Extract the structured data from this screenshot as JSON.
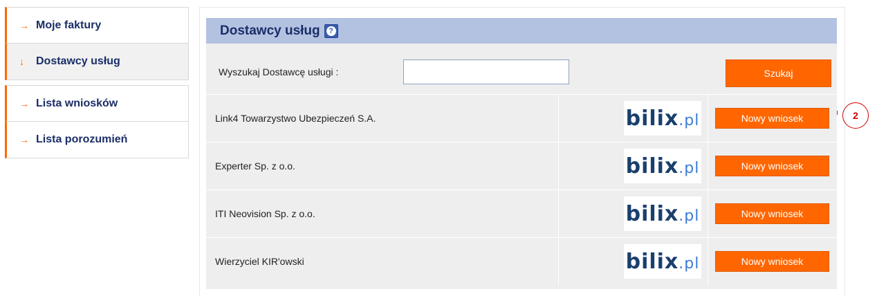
{
  "sidebar": {
    "items": [
      {
        "label": "Moje faktury",
        "arrow": "→",
        "active": false
      },
      {
        "label": "Dostawcy usług",
        "arrow": "↓",
        "active": true
      },
      {
        "label": "Lista wniosków",
        "arrow": "→",
        "active": false
      },
      {
        "label": "Lista porozumień",
        "arrow": "→",
        "active": false
      }
    ]
  },
  "panel": {
    "title": "Dostawcy usług",
    "help_icon": "question-icon",
    "search": {
      "label": "Wyszukaj Dostawcę usługi :",
      "value": "",
      "placeholder": "",
      "button_label": "Szukaj"
    },
    "providers": [
      {
        "name": "Link4 Towarzystwo Ubezpieczeń S.A.",
        "logo": "bilix.pl",
        "button_label": "Nowy wniosek"
      },
      {
        "name": "Experter Sp. z o.o.",
        "logo": "bilix.pl",
        "button_label": "Nowy wniosek"
      },
      {
        "name": "ITI Neovision Sp. z o.o.",
        "logo": "bilix.pl",
        "button_label": "Nowy wniosek"
      },
      {
        "name": "Wierzyciel KIR'owski",
        "logo": "bilix.pl",
        "button_label": "Nowy wniosek"
      }
    ]
  },
  "annotation": {
    "label": "2"
  },
  "colors": {
    "accent": "#ff6600",
    "header_bg": "#b4c2e2",
    "title_text": "#1a2d66",
    "panel_bg": "#eeeeee"
  }
}
